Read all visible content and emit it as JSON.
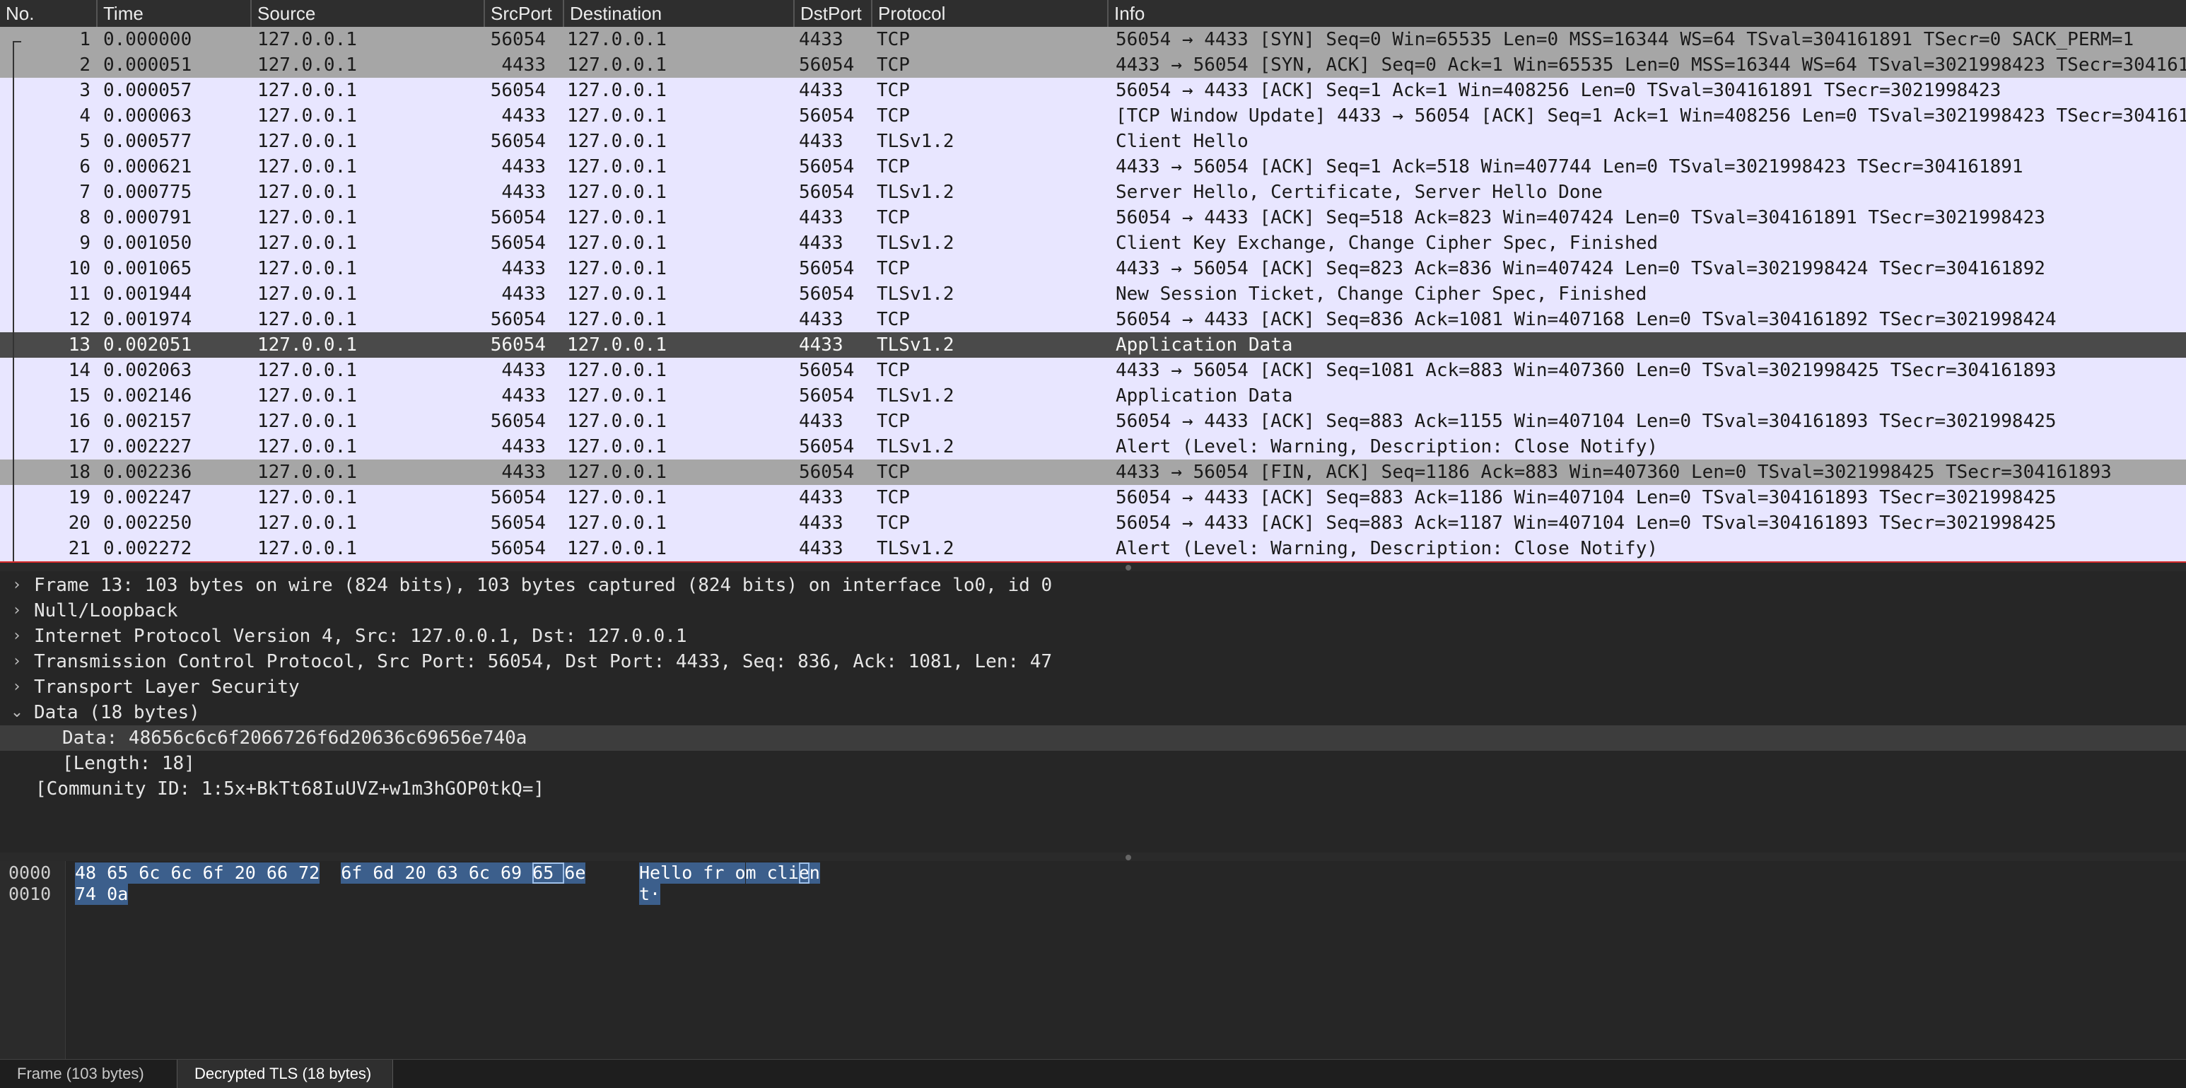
{
  "columns": [
    "No.",
    "Time",
    "Source",
    "SrcPort",
    "Destination",
    "DstPort",
    "Protocol",
    "Info"
  ],
  "packets": [
    {
      "no": "1",
      "time": "0.000000",
      "src": "127.0.0.1",
      "sport": "56054",
      "dst": "127.0.0.1",
      "dport": "4433",
      "proto": "TCP",
      "info": "56054 → 4433 [SYN] Seq=0 Win=65535 Len=0 MSS=16344 WS=64 TSval=304161891 TSecr=0 SACK_PERM=1",
      "style": "grey"
    },
    {
      "no": "2",
      "time": "0.000051",
      "src": "127.0.0.1",
      "sport": "4433",
      "dst": "127.0.0.1",
      "dport": "56054",
      "proto": "TCP",
      "info": "4433 → 56054 [SYN, ACK] Seq=0 Ack=1 Win=65535 Len=0 MSS=16344 WS=64 TSval=3021998423 TSecr=304161",
      "style": "grey"
    },
    {
      "no": "3",
      "time": "0.000057",
      "src": "127.0.0.1",
      "sport": "56054",
      "dst": "127.0.0.1",
      "dport": "4433",
      "proto": "TCP",
      "info": "56054 → 4433 [ACK] Seq=1 Ack=1 Win=408256 Len=0 TSval=304161891 TSecr=3021998423",
      "style": "normal"
    },
    {
      "no": "4",
      "time": "0.000063",
      "src": "127.0.0.1",
      "sport": "4433",
      "dst": "127.0.0.1",
      "dport": "56054",
      "proto": "TCP",
      "info": "[TCP Window Update] 4433 → 56054 [ACK] Seq=1 Ack=1 Win=408256 Len=0 TSval=3021998423 TSecr=304161",
      "style": "normal"
    },
    {
      "no": "5",
      "time": "0.000577",
      "src": "127.0.0.1",
      "sport": "56054",
      "dst": "127.0.0.1",
      "dport": "4433",
      "proto": "TLSv1.2",
      "info": "Client Hello",
      "style": "normal"
    },
    {
      "no": "6",
      "time": "0.000621",
      "src": "127.0.0.1",
      "sport": "4433",
      "dst": "127.0.0.1",
      "dport": "56054",
      "proto": "TCP",
      "info": "4433 → 56054 [ACK] Seq=1 Ack=518 Win=407744 Len=0 TSval=3021998423 TSecr=304161891",
      "style": "normal"
    },
    {
      "no": "7",
      "time": "0.000775",
      "src": "127.0.0.1",
      "sport": "4433",
      "dst": "127.0.0.1",
      "dport": "56054",
      "proto": "TLSv1.2",
      "info": "Server Hello, Certificate, Server Hello Done",
      "style": "normal"
    },
    {
      "no": "8",
      "time": "0.000791",
      "src": "127.0.0.1",
      "sport": "56054",
      "dst": "127.0.0.1",
      "dport": "4433",
      "proto": "TCP",
      "info": "56054 → 4433 [ACK] Seq=518 Ack=823 Win=407424 Len=0 TSval=304161891 TSecr=3021998423",
      "style": "normal"
    },
    {
      "no": "9",
      "time": "0.001050",
      "src": "127.0.0.1",
      "sport": "56054",
      "dst": "127.0.0.1",
      "dport": "4433",
      "proto": "TLSv1.2",
      "info": "Client Key Exchange, Change Cipher Spec, Finished",
      "style": "normal"
    },
    {
      "no": "10",
      "time": "0.001065",
      "src": "127.0.0.1",
      "sport": "4433",
      "dst": "127.0.0.1",
      "dport": "56054",
      "proto": "TCP",
      "info": "4433 → 56054 [ACK] Seq=823 Ack=836 Win=407424 Len=0 TSval=3021998424 TSecr=304161892",
      "style": "normal"
    },
    {
      "no": "11",
      "time": "0.001944",
      "src": "127.0.0.1",
      "sport": "4433",
      "dst": "127.0.0.1",
      "dport": "56054",
      "proto": "TLSv1.2",
      "info": "New Session Ticket, Change Cipher Spec, Finished",
      "style": "normal"
    },
    {
      "no": "12",
      "time": "0.001974",
      "src": "127.0.0.1",
      "sport": "56054",
      "dst": "127.0.0.1",
      "dport": "4433",
      "proto": "TCP",
      "info": "56054 → 4433 [ACK] Seq=836 Ack=1081 Win=407168 Len=0 TSval=304161892 TSecr=3021998424",
      "style": "normal"
    },
    {
      "no": "13",
      "time": "0.002051",
      "src": "127.0.0.1",
      "sport": "56054",
      "dst": "127.0.0.1",
      "dport": "4433",
      "proto": "TLSv1.2",
      "info": "Application Data",
      "style": "selected"
    },
    {
      "no": "14",
      "time": "0.002063",
      "src": "127.0.0.1",
      "sport": "4433",
      "dst": "127.0.0.1",
      "dport": "56054",
      "proto": "TCP",
      "info": "4433 → 56054 [ACK] Seq=1081 Ack=883 Win=407360 Len=0 TSval=3021998425 TSecr=304161893",
      "style": "normal"
    },
    {
      "no": "15",
      "time": "0.002146",
      "src": "127.0.0.1",
      "sport": "4433",
      "dst": "127.0.0.1",
      "dport": "56054",
      "proto": "TLSv1.2",
      "info": "Application Data",
      "style": "normal"
    },
    {
      "no": "16",
      "time": "0.002157",
      "src": "127.0.0.1",
      "sport": "56054",
      "dst": "127.0.0.1",
      "dport": "4433",
      "proto": "TCP",
      "info": "56054 → 4433 [ACK] Seq=883 Ack=1155 Win=407104 Len=0 TSval=304161893 TSecr=3021998425",
      "style": "normal"
    },
    {
      "no": "17",
      "time": "0.002227",
      "src": "127.0.0.1",
      "sport": "4433",
      "dst": "127.0.0.1",
      "dport": "56054",
      "proto": "TLSv1.2",
      "info": "Alert (Level: Warning, Description: Close Notify)",
      "style": "normal"
    },
    {
      "no": "18",
      "time": "0.002236",
      "src": "127.0.0.1",
      "sport": "4433",
      "dst": "127.0.0.1",
      "dport": "56054",
      "proto": "TCP",
      "info": "4433 → 56054 [FIN, ACK] Seq=1186 Ack=883 Win=407360 Len=0 TSval=3021998425 TSecr=304161893",
      "style": "grey"
    },
    {
      "no": "19",
      "time": "0.002247",
      "src": "127.0.0.1",
      "sport": "56054",
      "dst": "127.0.0.1",
      "dport": "4433",
      "proto": "TCP",
      "info": "56054 → 4433 [ACK] Seq=883 Ack=1186 Win=407104 Len=0 TSval=304161893 TSecr=3021998425",
      "style": "normal"
    },
    {
      "no": "20",
      "time": "0.002250",
      "src": "127.0.0.1",
      "sport": "56054",
      "dst": "127.0.0.1",
      "dport": "4433",
      "proto": "TCP",
      "info": "56054 → 4433 [ACK] Seq=883 Ack=1187 Win=407104 Len=0 TSval=304161893 TSecr=3021998425",
      "style": "normal"
    },
    {
      "no": "21",
      "time": "0.002272",
      "src": "127.0.0.1",
      "sport": "56054",
      "dst": "127.0.0.1",
      "dport": "4433",
      "proto": "TLSv1.2",
      "info": "Alert (Level: Warning, Description: Close Notify)",
      "style": "normal"
    }
  ],
  "details": [
    {
      "arrow": "›",
      "text": "Frame 13: 103 bytes on wire (824 bits), 103 bytes captured (824 bits) on interface lo0, id 0",
      "indent": 0,
      "highlight": false
    },
    {
      "arrow": "›",
      "text": "Null/Loopback",
      "indent": 0,
      "highlight": false
    },
    {
      "arrow": "›",
      "text": "Internet Protocol Version 4, Src: 127.0.0.1, Dst: 127.0.0.1",
      "indent": 0,
      "highlight": false
    },
    {
      "arrow": "›",
      "text": "Transmission Control Protocol, Src Port: 56054, Dst Port: 4433, Seq: 836, Ack: 1081, Len: 47",
      "indent": 0,
      "highlight": false
    },
    {
      "arrow": "›",
      "text": "Transport Layer Security",
      "indent": 0,
      "highlight": false
    },
    {
      "arrow": "⌄",
      "text": "Data (18 bytes)",
      "indent": 0,
      "highlight": false
    },
    {
      "arrow": "",
      "text": "Data: 48656c6c6f2066726f6d20636c69656e740a",
      "indent": 1,
      "highlight": true
    },
    {
      "arrow": "",
      "text": "[Length: 18]",
      "indent": 1,
      "highlight": false
    },
    {
      "arrow": "",
      "text": "[Community ID: 1:5x+BkTt68IuUVZ+w1m3hGOP0tkQ=]",
      "indent": 0,
      "highlight": false
    }
  ],
  "bytes": {
    "offsets": [
      "0000",
      "0010"
    ],
    "hex": [
      [
        "48",
        "65",
        "6c",
        "6c",
        "6f",
        "20",
        "66",
        "72",
        "6f",
        "6d",
        "20",
        "63",
        "6c",
        "69",
        "65",
        "6e"
      ],
      [
        "74",
        "0a"
      ]
    ],
    "ascii": [
      [
        "H",
        "e",
        "l",
        "l",
        "o",
        " ",
        "f",
        "r",
        "o",
        "m",
        " ",
        "c",
        "l",
        "i",
        "e",
        "n"
      ],
      [
        "t",
        "·"
      ]
    ],
    "cursor_byte": 14
  },
  "tabs": [
    {
      "label": "Frame (103 bytes)",
      "active": false
    },
    {
      "label": "Decrypted TLS (18 bytes)",
      "active": true
    }
  ]
}
